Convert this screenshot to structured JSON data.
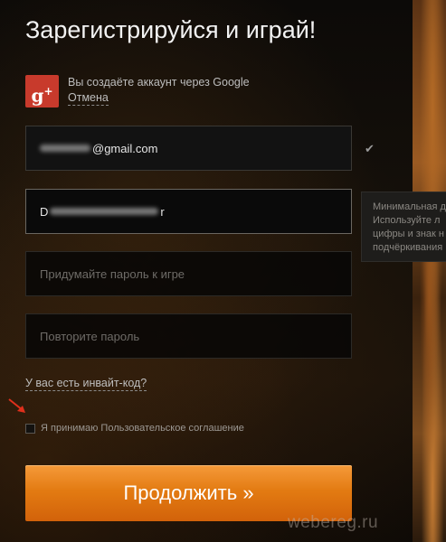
{
  "page": {
    "title": "Зарегистрируйся и играй!"
  },
  "google": {
    "icon_text": "g",
    "icon_plus": "+",
    "message": "Вы создаёте аккаунт через Google",
    "cancel_label": "Отмена"
  },
  "form": {
    "email": {
      "visible_value": "@gmail.com",
      "valid_mark": "✔"
    },
    "nickname": {
      "first_char": "D",
      "last_char": "r"
    },
    "nickname_hint": {
      "lines": [
        "Минимальная д",
        "Используйте л",
        "цифры и знак н",
        "подчёркивания"
      ]
    },
    "password": {
      "placeholder": "Придумайте пароль к игре"
    },
    "password_repeat": {
      "placeholder": "Повторите пароль"
    },
    "invite_label": "У вас есть инвайт-код?",
    "agreement_label": "Я принимаю Пользовательское соглашение",
    "submit_label": "Продолжить »"
  },
  "watermark": "webereg.ru",
  "colors": {
    "accent_orange": "#e37b12",
    "google_red": "#c83a2c",
    "arrow_red": "#e0301c"
  }
}
